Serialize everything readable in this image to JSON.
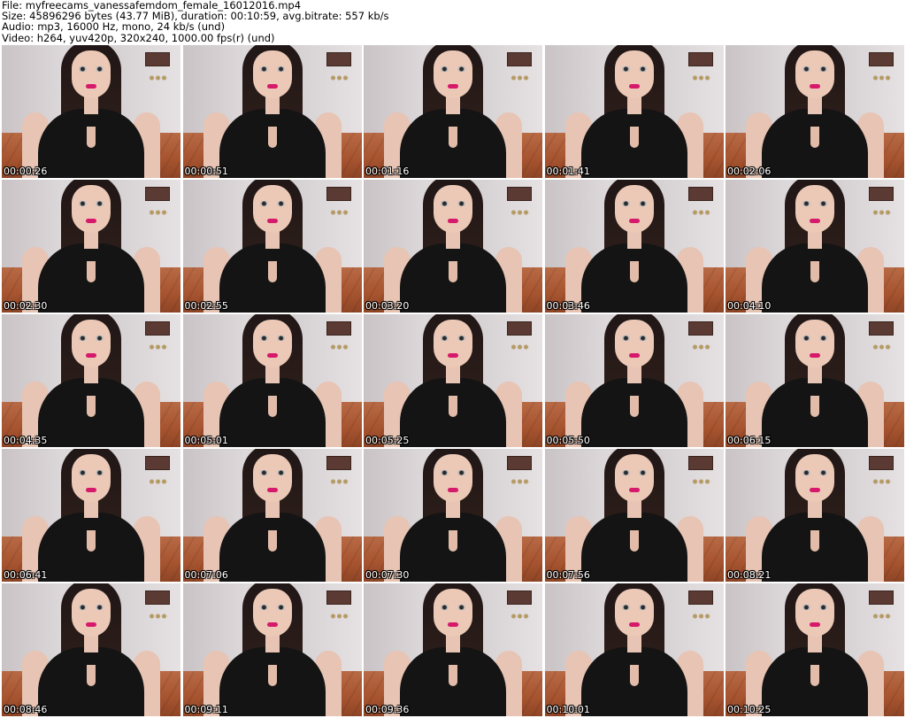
{
  "header": {
    "file_line": "File: myfreecams_vanessafemdom_female_16012016.mp4",
    "size_line": "Size: 45896296 bytes (43.77 MiB), duration: 00:10:59, avg.bitrate: 557 kb/s",
    "audio_line": "Audio: mp3, 16000 Hz, mono, 24 kb/s (und)",
    "video_line": "Video: h264, yuv420p, 320x240, 1000.00 fps(r) (und)"
  },
  "thumbnails": [
    {
      "timestamp": "00:00:26"
    },
    {
      "timestamp": "00:00:51"
    },
    {
      "timestamp": "00:01:16"
    },
    {
      "timestamp": "00:01:41"
    },
    {
      "timestamp": "00:02:06"
    },
    {
      "timestamp": "00:02:30"
    },
    {
      "timestamp": "00:02:55"
    },
    {
      "timestamp": "00:03:20"
    },
    {
      "timestamp": "00:03:46"
    },
    {
      "timestamp": "00:04:10"
    },
    {
      "timestamp": "00:04:35"
    },
    {
      "timestamp": "00:05:01"
    },
    {
      "timestamp": "00:05:25"
    },
    {
      "timestamp": "00:05:50"
    },
    {
      "timestamp": "00:06:15"
    },
    {
      "timestamp": "00:06:41"
    },
    {
      "timestamp": "00:07:06"
    },
    {
      "timestamp": "00:07:30"
    },
    {
      "timestamp": "00:07:56"
    },
    {
      "timestamp": "00:08:21"
    },
    {
      "timestamp": "00:08:46"
    },
    {
      "timestamp": "00:09:11"
    },
    {
      "timestamp": "00:09:36"
    },
    {
      "timestamp": "00:10:01"
    },
    {
      "timestamp": "00:10:25"
    }
  ]
}
